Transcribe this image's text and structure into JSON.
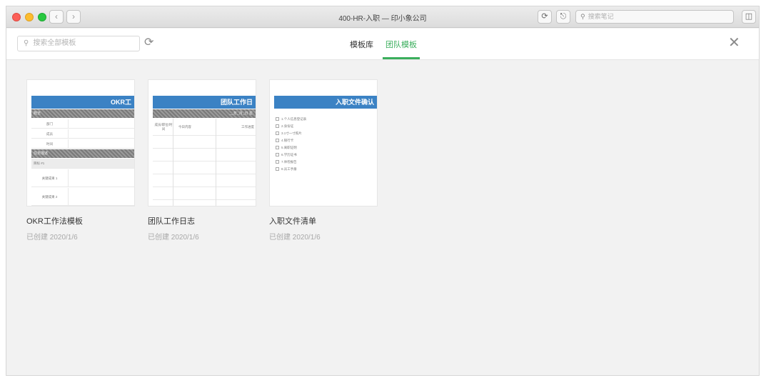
{
  "window": {
    "title": "400-HR-入职 — 印小象公司",
    "search_placeholder": "搜索笔记"
  },
  "toolbar": {
    "search_placeholder": "搜索全部模板",
    "tabs": [
      {
        "label": "模板库",
        "active": false
      },
      {
        "label": "团队模板",
        "active": true
      }
    ],
    "accent_color": "#3aae5c"
  },
  "templates": [
    {
      "name": "OKR工作法模板",
      "date": "已创建 2020/1/6",
      "thumb": {
        "heading": "OKR工",
        "section1": "概览",
        "rows": [
          "部门",
          "成员",
          "时间"
        ],
        "section2": "任务描述",
        "subhead": "目标 #1",
        "results": [
          "关键成果 1",
          "关键成果 2"
        ]
      }
    },
    {
      "name": "团队工作日志",
      "date": "已创建 2020/1/6",
      "thumb": {
        "heading": "团队工作日",
        "subline": "__年_月_日  星",
        "cols": [
          "成员/职位/时间",
          "今日内容",
          "工作进度"
        ]
      }
    },
    {
      "name": "入职文件清单",
      "date": "已创建 2020/1/6",
      "thumb": {
        "heading": "入职文件确认",
        "items": [
          "1.个人信息登记表",
          "2.身份证",
          "3.1寸一寸照片",
          "4.银行卡",
          "5.离职证明",
          "6.学历证书",
          "7.体检报告",
          "8.员工手册"
        ]
      }
    }
  ]
}
